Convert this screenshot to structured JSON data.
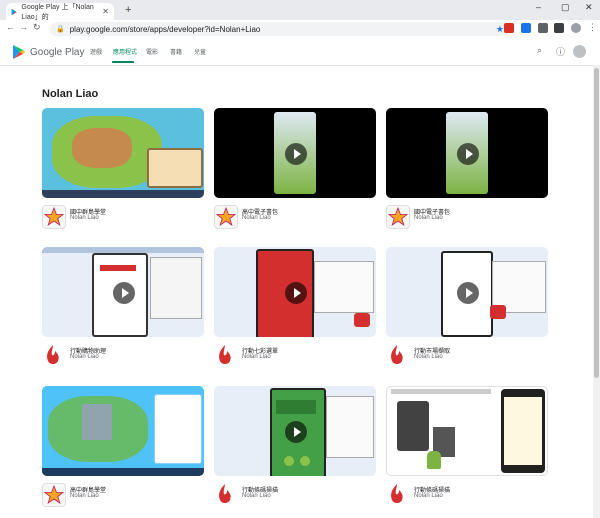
{
  "browser": {
    "tab_title": "Google Play 上「Nolan Liao」的",
    "tab_close": "✕",
    "new_tab": "+",
    "url": "play.google.com/store/apps/developer?id=Nolan+Liao",
    "win_min": "–",
    "win_max": "▢",
    "win_close": "✕"
  },
  "header": {
    "logo_text": "Google Play",
    "nav": [
      "遊戲",
      "應用程式",
      "電影",
      "書籍",
      "兒童"
    ],
    "active_index": 1
  },
  "developer": {
    "name": "Nolan Liao"
  },
  "apps": [
    {
      "title": "國中群島學堂",
      "developer": "Nolan Liao",
      "has_video": false
    },
    {
      "title": "高中電子書包",
      "developer": "Nolan Liao",
      "has_video": true
    },
    {
      "title": "國中電子書包",
      "developer": "Nolan Liao",
      "has_video": true
    },
    {
      "title": "行動購物助理",
      "developer": "Nolan Liao",
      "has_video": true
    },
    {
      "title": "行動七彩選單",
      "developer": "Nolan Liao",
      "has_video": true
    },
    {
      "title": "行動市場擷取",
      "developer": "Nolan Liao",
      "has_video": true
    },
    {
      "title": "高中群島學堂",
      "developer": "Nolan Liao",
      "has_video": false
    },
    {
      "title": "行動條碼掃描",
      "developer": "Nolan Liao",
      "has_video": true
    },
    {
      "title": "行動條碼掃描",
      "developer": "Nolan Liao",
      "has_video": false
    }
  ]
}
